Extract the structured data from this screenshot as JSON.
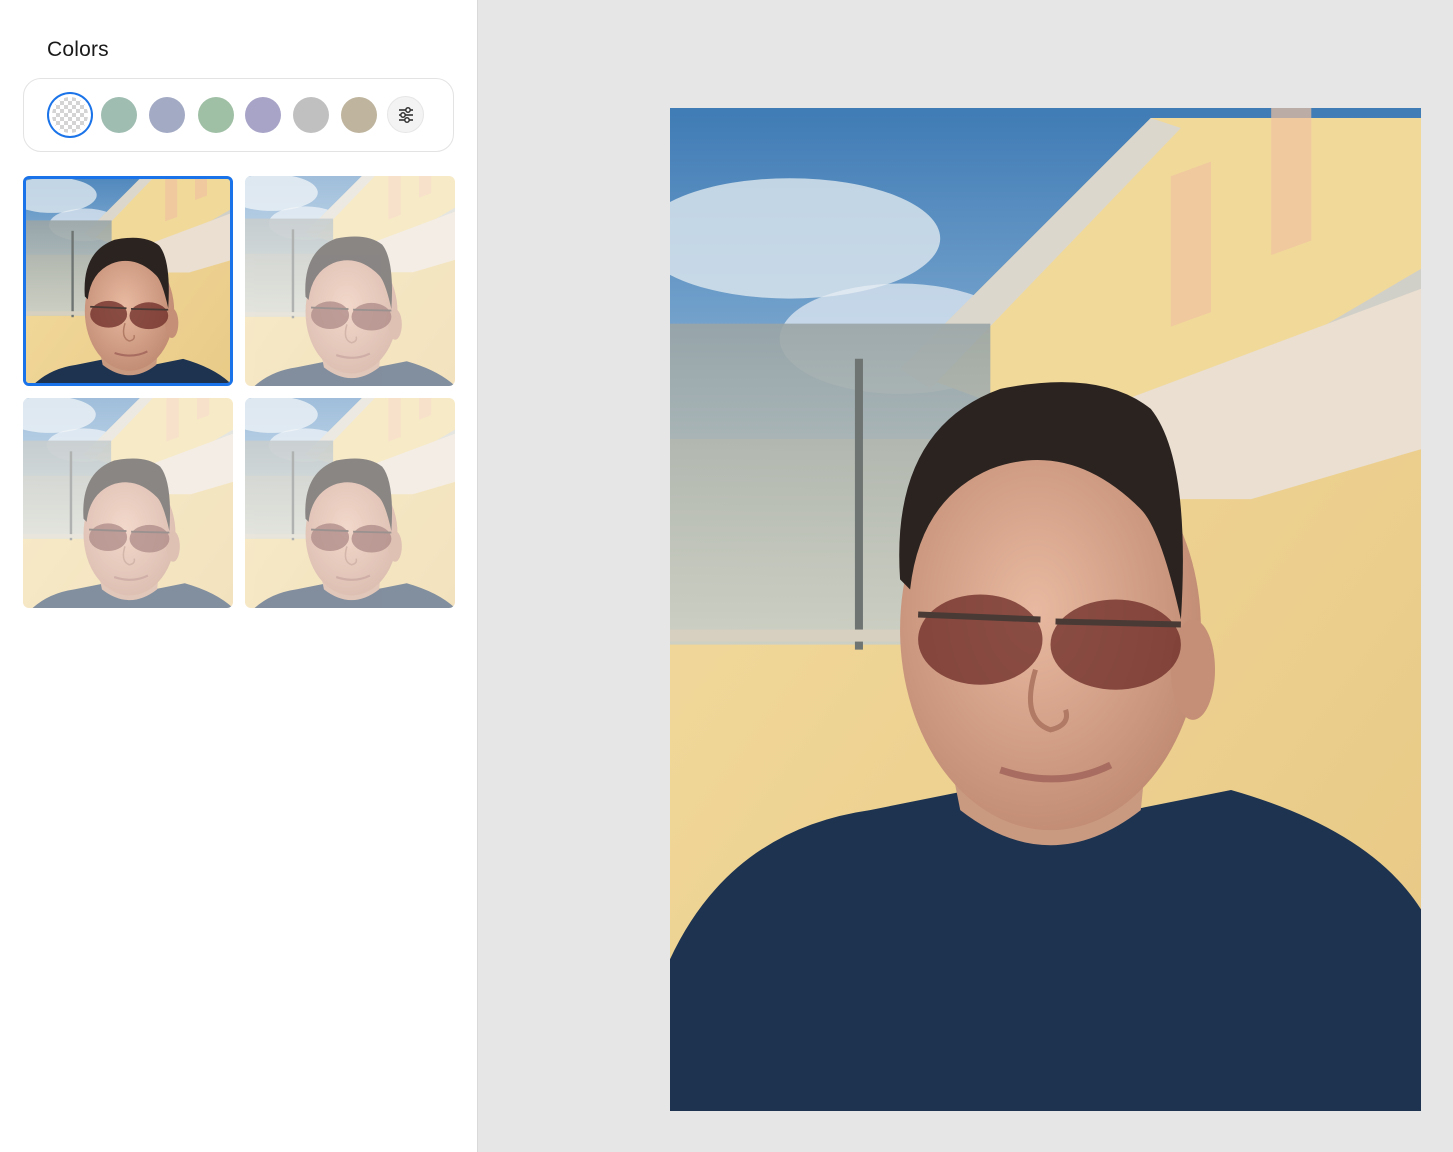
{
  "sidebar": {
    "title": "Colors",
    "swatches": [
      {
        "name": "transparent",
        "color": "transparent",
        "selected": true
      },
      {
        "name": "sage",
        "color": "#9fbdb1"
      },
      {
        "name": "slate-blue",
        "color": "#a3aac4"
      },
      {
        "name": "mint",
        "color": "#a0c0a6"
      },
      {
        "name": "lavender",
        "color": "#a8a4c8"
      },
      {
        "name": "grey",
        "color": "#c0c0c0"
      },
      {
        "name": "taupe",
        "color": "#bfb49d"
      }
    ],
    "adjust_icon": "sliders-icon",
    "variants": [
      {
        "id": "variant-1",
        "selected": true,
        "lens": "dark-red"
      },
      {
        "id": "variant-2",
        "selected": false,
        "lens": "light-grey"
      },
      {
        "id": "variant-3",
        "selected": false,
        "lens": "clear"
      },
      {
        "id": "variant-4",
        "selected": false,
        "lens": "dark-red"
      }
    ]
  },
  "canvas": {
    "subject": "selfie-photo-with-sunglasses"
  }
}
